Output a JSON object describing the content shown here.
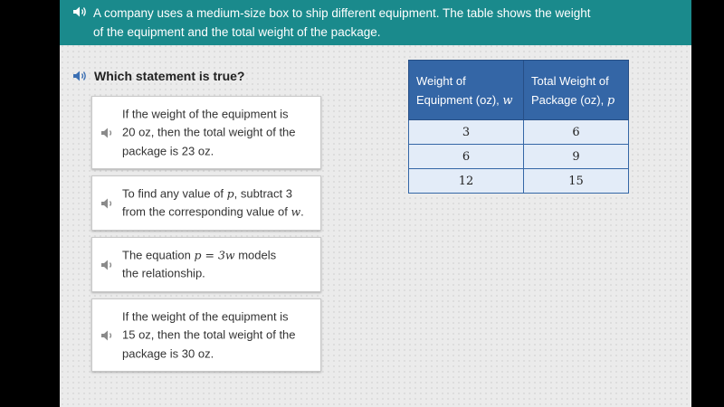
{
  "banner": {
    "line1": "A company uses a medium-size box to ship different equipment. The table shows the weight",
    "line2": "of the equipment and the total weight of the package."
  },
  "question": {
    "text": "Which statement is true?"
  },
  "options": [
    {
      "lines": [
        "If the weight of the equipment is",
        "20 oz, then the total weight of the",
        "package is 23 oz."
      ]
    },
    {
      "l1_pre": "To find any value of ",
      "l1_var": "p",
      "l1_post": ", subtract 3",
      "l2_pre": "from the corresponding value of ",
      "l2_var": "w",
      "l2_post": "."
    },
    {
      "l1_pre": "The equation ",
      "l1_math": "p = 3w",
      "l1_post": " models",
      "l2": "the relationship."
    },
    {
      "lines": [
        "If the weight of the equipment is",
        "15 oz, then the total weight of the",
        "package is 30 oz."
      ]
    }
  ],
  "table": {
    "headers": [
      {
        "line1": "Weight of",
        "line2": "Equipment (oz), ",
        "var": "w"
      },
      {
        "line1": "Total Weight of",
        "line2": "Package (oz), ",
        "var": "p"
      }
    ],
    "rows": [
      [
        "3",
        "6"
      ],
      [
        "6",
        "9"
      ],
      [
        "12",
        "15"
      ]
    ]
  },
  "icons": {
    "speaker": "speaker-icon"
  },
  "colors": {
    "banner": "#1a8a8c",
    "table_header": "#3466a6",
    "table_cell": "#e3ecf8",
    "speaker_blue": "#3b6fb3"
  }
}
